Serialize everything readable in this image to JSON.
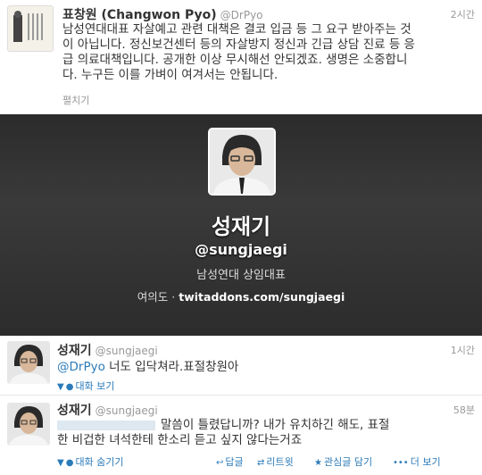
{
  "tweet1": {
    "name": "표창원 (Changwon Pyo)",
    "handle": "@DrPyo",
    "time": "2시간",
    "text_lines": [
      "남성연대대표 자살예고 관련 대책은 결코 입금 등 그 요구 받아주는 것",
      "이 아닙니다. 정신보건센터 등의 자살방지 정신과 긴급 상담 진료 등 응",
      "급 의료대책입니다. 공개한 이상 무시해선 안되겠죠. 생명은 소중합니",
      "다. 누구든 이를 가벼이 여겨서는 안됩니다."
    ],
    "expand": "펼치기"
  },
  "profile": {
    "name": "성재기",
    "handle": "@sungjaegi",
    "bio": "남성연대 상임대표",
    "location": "여의도",
    "separator": "·",
    "url": "twitaddons.com/sungjaegi"
  },
  "tweet2": {
    "name": "성재기",
    "handle": "@sungjaegi",
    "time": "1시간",
    "mention": "@DrPyo",
    "text": " 너도 입닥쳐라.표절창원아",
    "action": "대화 보기"
  },
  "tweet3": {
    "name": "성재기",
    "handle": "@sungjaegi",
    "time": "58분",
    "line1": "말씀이 틀렸답니까? 내가 유치하긴 해도, 표절",
    "line2": "한 비겁한 녀석한테 한소리 듣고 싶지 않다는거죠",
    "actions": {
      "hide": "대화 숨기기",
      "reply": "답글",
      "retweet": "리트윗",
      "favorite": "관심글 담기",
      "more": "더 보기"
    }
  },
  "colors": {
    "link": "#2b7bb9",
    "muted": "#999999",
    "card_bg": "#2f2f2f"
  }
}
